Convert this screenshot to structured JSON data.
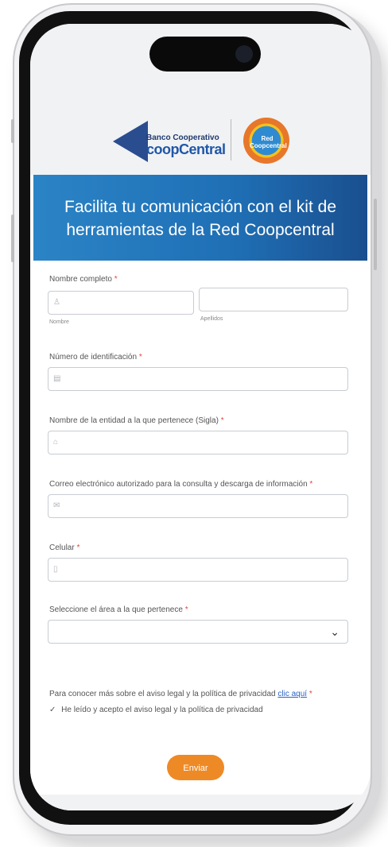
{
  "header": {
    "bank_line1": "Banco Cooperativo",
    "bank_line2": "coopCentral",
    "badge_text": "Red Coopcentral"
  },
  "banner": {
    "title": "Facilita tu comunicación con el kit de herramientas de la Red Coopcentral"
  },
  "form": {
    "full_name_label": "Nombre completo",
    "first_name_sublabel": "Nombre",
    "last_name_sublabel": "Apellidos",
    "id_label": "Número de identificación",
    "entity_label": "Nombre de la entidad a la que pertenece (Sigla)",
    "email_label": "Correo electrónico autorizado para la consulta y descarga de información",
    "phone_label": "Celular",
    "area_label": "Seleccione el área a la que pertenece",
    "required_mark": "*",
    "privacy_text": "Para conocer más sobre el aviso legal y la política de privacidad",
    "privacy_link": "clic aquí",
    "consent_text": "He leído y acepto el aviso legal y la política de privacidad",
    "submit_label": "Enviar"
  },
  "colors": {
    "banner_start": "#2b84c6",
    "banner_end": "#1a4f8f",
    "submit": "#ee8a25",
    "required": "#e0473f",
    "link": "#2b63c6"
  },
  "icons": {
    "first_name": "user-icon",
    "id": "id-card-icon",
    "entity": "tag-icon",
    "email": "mail-icon",
    "phone": "phone-icon",
    "select": "chevron-down-icon",
    "consent": "checkmark-icon"
  }
}
